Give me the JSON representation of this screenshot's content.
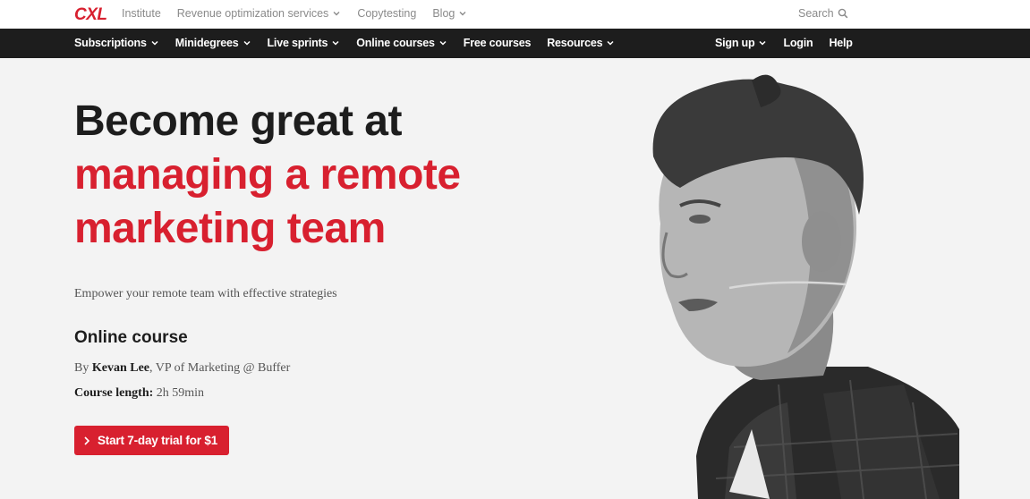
{
  "topbar": {
    "logo": "CXL",
    "links": [
      {
        "label": "Institute",
        "has_dropdown": false
      },
      {
        "label": "Revenue optimization services",
        "has_dropdown": true
      },
      {
        "label": "Copytesting",
        "has_dropdown": false
      },
      {
        "label": "Blog",
        "has_dropdown": true
      }
    ],
    "search_label": "Search"
  },
  "nav": {
    "left": [
      {
        "label": "Subscriptions",
        "has_dropdown": true
      },
      {
        "label": "Minidegrees",
        "has_dropdown": true
      },
      {
        "label": "Live sprints",
        "has_dropdown": true
      },
      {
        "label": "Online courses",
        "has_dropdown": true
      },
      {
        "label": "Free courses",
        "has_dropdown": false
      },
      {
        "label": "Resources",
        "has_dropdown": true
      }
    ],
    "right": [
      {
        "label": "Sign up",
        "has_dropdown": true
      },
      {
        "label": "Login",
        "has_dropdown": false
      },
      {
        "label": "Help",
        "has_dropdown": false
      }
    ]
  },
  "hero": {
    "headline_line1": "Become great at",
    "headline_line2": "managing a remote",
    "headline_line3": "marketing team",
    "subtitle": "Empower your remote team with effective strategies",
    "course_type": "Online course",
    "by_prefix": "By ",
    "instructor": "Kevan Lee",
    "instructor_title": ", VP of Marketing @ Buffer",
    "length_label": "Course length:",
    "length_value": " 2h 59min",
    "cta_label": "Start 7-day trial for $1"
  },
  "colors": {
    "brand_red": "#d8202f",
    "nav_bg": "#1d1d1d",
    "hero_bg": "#f3f3f3"
  },
  "icons": {
    "search": "search-icon",
    "dropdown": "chevron-down-icon",
    "cta": "chevron-right-icon"
  }
}
